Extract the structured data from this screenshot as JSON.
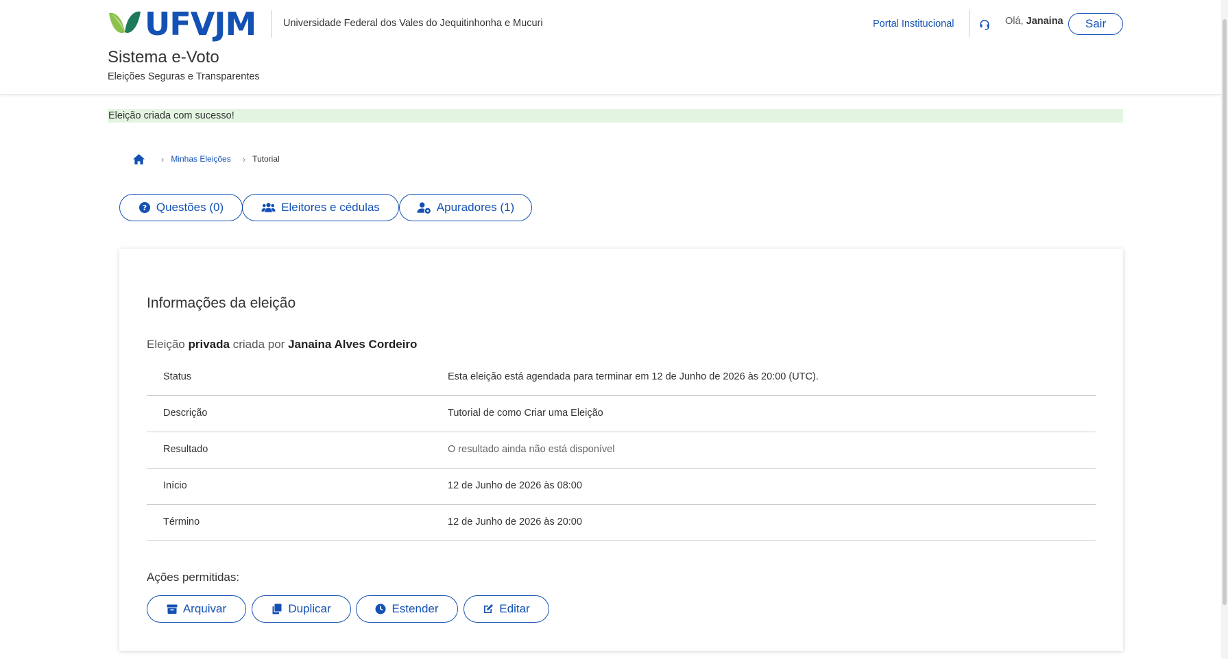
{
  "header": {
    "logo_text": "UFVJM",
    "university": "Universidade Federal dos Vales do Jequitinhonha e Mucuri",
    "system_title": "Sistema e-Voto",
    "system_subtitle": "Eleições Seguras e Transparentes",
    "portal_link": "Portal Institucional",
    "greeting_prefix": "Olá,",
    "user_name": "Janaina",
    "logout_label": "Sair"
  },
  "alert": {
    "message": "Eleição criada com sucesso!"
  },
  "breadcrumb": {
    "items": [
      {
        "label": "Minhas Eleições"
      },
      {
        "label": "Tutorial"
      }
    ]
  },
  "tabs": [
    {
      "label": "Questões (0)",
      "icon": "question-circle-icon"
    },
    {
      "label": "Eleitores e cédulas",
      "icon": "users-icon"
    },
    {
      "label": "Apuradores (1)",
      "icon": "user-gear-icon"
    }
  ],
  "card": {
    "title": "Informações da eleição",
    "creator_prefix": "Eleição",
    "visibility": "privada",
    "creator_mid": "criada por",
    "creator_name": "Janaina Alves Cordeiro",
    "rows": [
      {
        "key": "Status",
        "value": "Esta eleição está agendada para terminar em 12 de Junho de 2026 às 20:00 (UTC)."
      },
      {
        "key": "Descrição",
        "value": "Tutorial de como Criar uma Eleição"
      },
      {
        "key": "Resultado",
        "value": "O resultado ainda não está disponível"
      },
      {
        "key": "Início",
        "value": "12 de Junho de 2026 às 08:00"
      },
      {
        "key": "Término",
        "value": "12 de Junho de 2026 às 20:00"
      }
    ],
    "actions_label": "Ações permitidas:",
    "actions": [
      {
        "label": "Arquivar",
        "icon": "archive-icon"
      },
      {
        "label": "Duplicar",
        "icon": "copy-icon"
      },
      {
        "label": "Estender",
        "icon": "clock-icon"
      },
      {
        "label": "Editar",
        "icon": "edit-icon"
      }
    ]
  },
  "colors": {
    "primary": "#1351b4",
    "logo_green": "#8cc14b",
    "alert_bg": "#e3f5e1"
  }
}
